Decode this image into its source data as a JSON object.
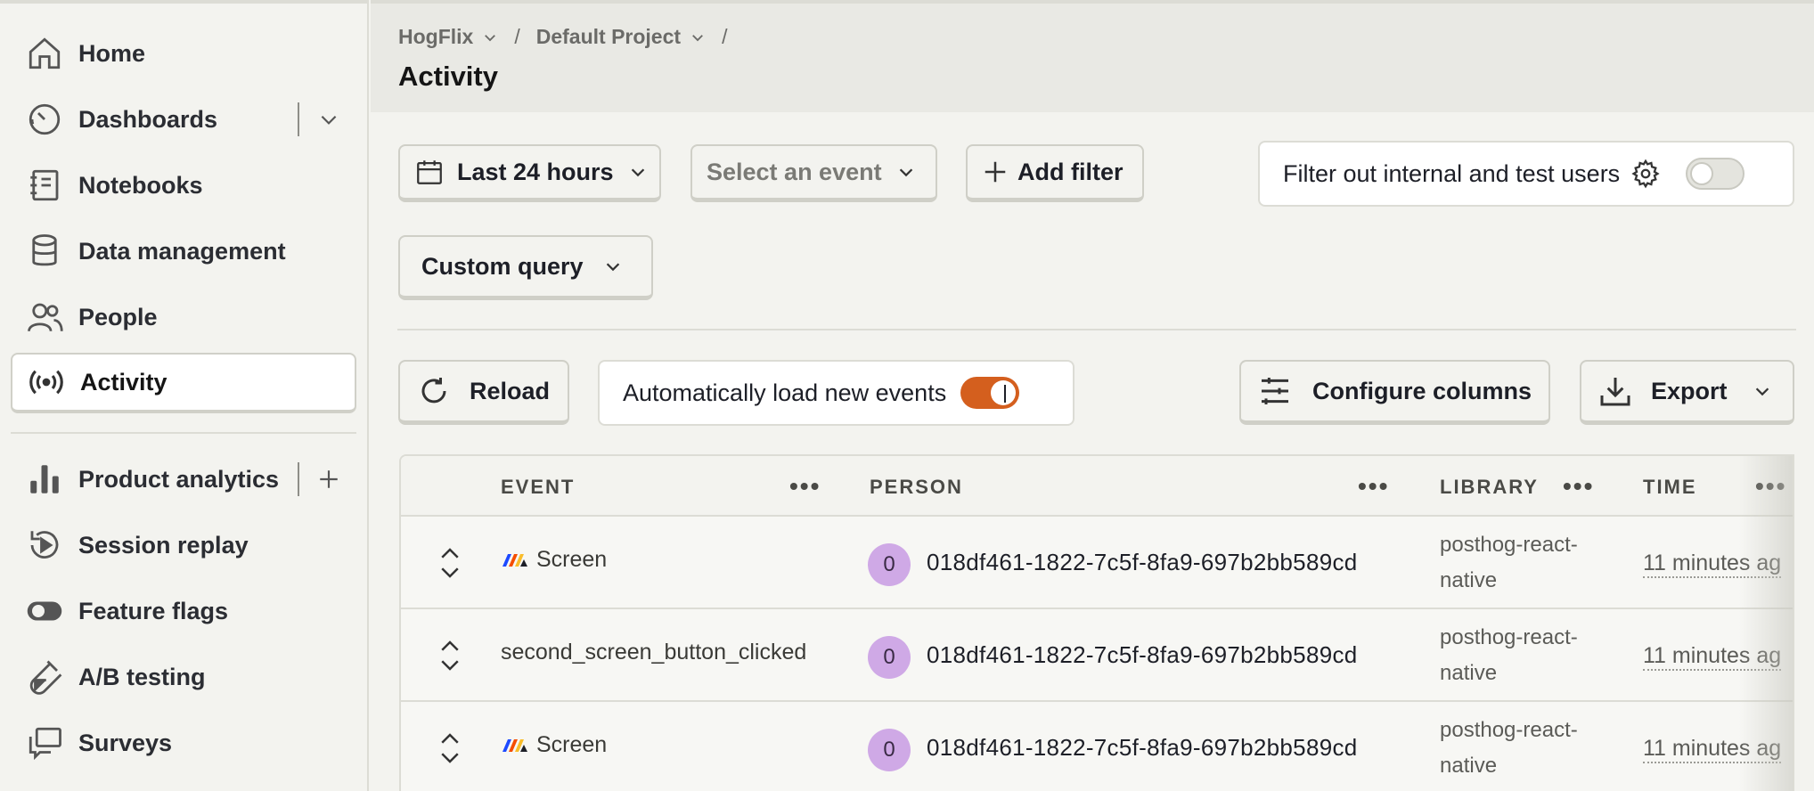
{
  "sidebar": {
    "items": [
      {
        "label": "Home",
        "icon": "home-icon"
      },
      {
        "label": "Dashboards",
        "icon": "dashboard-icon"
      },
      {
        "label": "Notebooks",
        "icon": "notebook-icon"
      },
      {
        "label": "Data management",
        "icon": "database-icon"
      },
      {
        "label": "People",
        "icon": "people-icon"
      },
      {
        "label": "Activity",
        "icon": "activity-icon"
      },
      {
        "label": "Product analytics",
        "icon": "bar-chart-icon"
      },
      {
        "label": "Session replay",
        "icon": "replay-icon"
      },
      {
        "label": "Feature flags",
        "icon": "toggle-icon"
      },
      {
        "label": "A/B testing",
        "icon": "flask-icon"
      },
      {
        "label": "Surveys",
        "icon": "chat-icon"
      }
    ]
  },
  "header": {
    "breadcrumb": [
      "HogFlix",
      "Default Project"
    ],
    "title": "Activity"
  },
  "filters": {
    "date_range": "Last 24 hours",
    "event_placeholder": "Select an event",
    "add_filter": "Add filter",
    "internal_users": "Filter out internal and test users",
    "internal_users_enabled": false,
    "custom_query": "Custom query"
  },
  "toolbar": {
    "reload": "Reload",
    "auto_load": "Automatically load new events",
    "auto_load_enabled": true,
    "configure_columns": "Configure columns",
    "export": "Export"
  },
  "table": {
    "columns": [
      "EVENT",
      "PERSON",
      "LIBRARY",
      "TIME"
    ],
    "rows": [
      {
        "event": "Screen",
        "event_icon": true,
        "avatar": "0",
        "person": "018df461-1822-7c5f-8fa9-697b2bb589cd",
        "library_line1": "posthog-react-",
        "library_line2": "native",
        "time": "11 minutes ag"
      },
      {
        "event": "second_screen_button_clicked",
        "event_icon": false,
        "avatar": "0",
        "person": "018df461-1822-7c5f-8fa9-697b2bb589cd",
        "library_line1": "posthog-react-",
        "library_line2": "native",
        "time": "11 minutes ag"
      },
      {
        "event": "Screen",
        "event_icon": true,
        "avatar": "0",
        "person": "018df461-1822-7c5f-8fa9-697b2bb589cd",
        "library_line1": "posthog-react-",
        "library_line2": "native",
        "time": "11 minutes ag"
      }
    ]
  },
  "colors": {
    "accent": "#d45f1e",
    "avatar": "#cfa9e6",
    "background": "#f3f3ef"
  }
}
